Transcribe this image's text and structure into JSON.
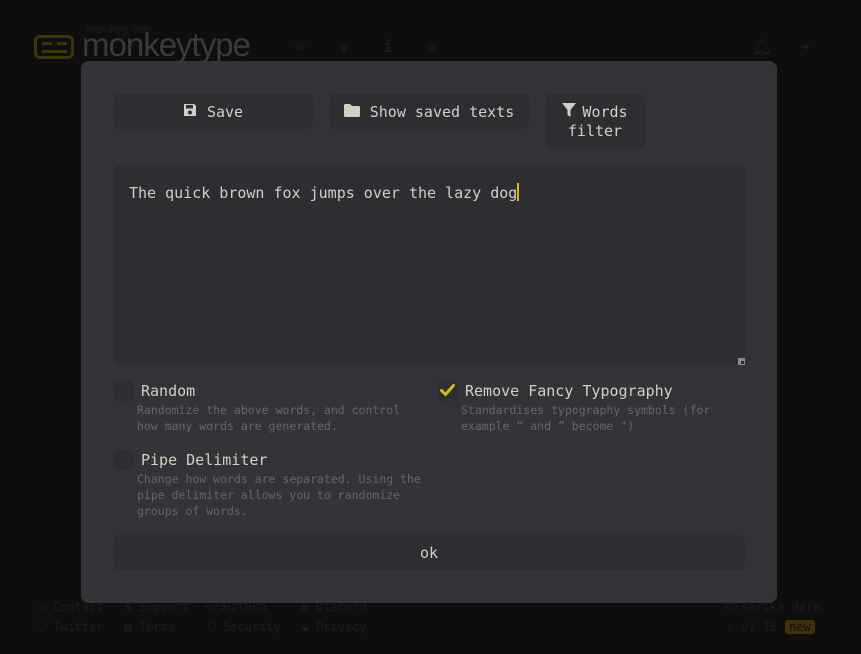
{
  "header": {
    "logo_subtitle": "monkey see",
    "logo_title": "monkeytype",
    "nav_icons": [
      "keyboard-icon",
      "crown-icon",
      "info-icon",
      "gear-icon"
    ],
    "right_icons": [
      "bell-icon",
      "sign-in-icon"
    ]
  },
  "modal": {
    "buttons": {
      "save": "Save",
      "show_saved": "Show saved texts",
      "words_filter_line1": "Words",
      "words_filter_line2": "filter",
      "ok": "ok"
    },
    "text_value": "The quick brown fox jumps over the lazy dog",
    "options": {
      "random": {
        "title": "Random",
        "description": "Randomize the above words, and control how many words are generated.",
        "checked": false
      },
      "pipe": {
        "title": "Pipe Delimiter",
        "description": "Change how words are separated. Using the pipe delimiter allows you to randomize groups of words.",
        "checked": false
      },
      "fancy": {
        "title": "Remove Fancy Typography",
        "description": "Standardises typography symbols (for example “ and ” become \")",
        "checked": true
      }
    }
  },
  "footer": {
    "links": {
      "contact": "Contact",
      "support": "Support",
      "github": "GitHub",
      "discord": "Discord",
      "twitter": "Twitter",
      "terms": "Terms",
      "security": "Security",
      "privacy": "Privacy"
    },
    "theme": "serika dark",
    "version": "v1.16",
    "new_badge": "new"
  },
  "colors": {
    "accent": "#e2b714",
    "background": "#323437",
    "sub_background": "#2c2e31",
    "text": "#d1d0c5",
    "sub_text": "#646669"
  }
}
